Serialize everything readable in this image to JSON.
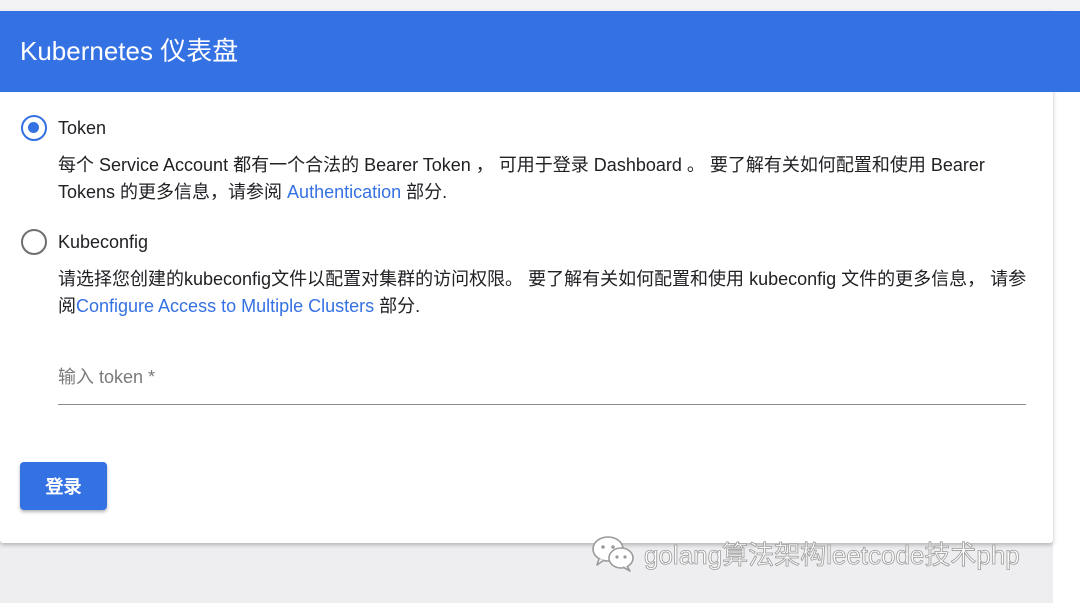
{
  "header": {
    "title": "Kubernetes 仪表盘"
  },
  "auth_options": [
    {
      "label": "Token",
      "selected": true,
      "desc_text": "每个 Service Account 都有一个合法的 Bearer Token ， 可用于登录 Dashboard 。 要了解有关如何配置和使用 Bearer Tokens 的更多信息，请参阅 ",
      "link": "Authentication",
      "desc_suffix": " 部分."
    },
    {
      "label": "Kubeconfig",
      "selected": false,
      "desc_text": "请选择您创建的kubeconfig文件以配置对集群的访问权限。 要了解有关如何配置和使用 kubeconfig 文件的更多信息， 请参阅",
      "link": "Configure Access to Multiple Clusters",
      "desc_suffix": " 部分."
    }
  ],
  "token_input": {
    "placeholder": "输入 token *",
    "value": ""
  },
  "login_button": {
    "label": "登录"
  },
  "watermark": {
    "icon": "wechat-icon",
    "text": "golang算法架构leetcode技术php"
  },
  "colors": {
    "primary": "#3471e3",
    "link": "#3471e3",
    "text": "#202124"
  }
}
